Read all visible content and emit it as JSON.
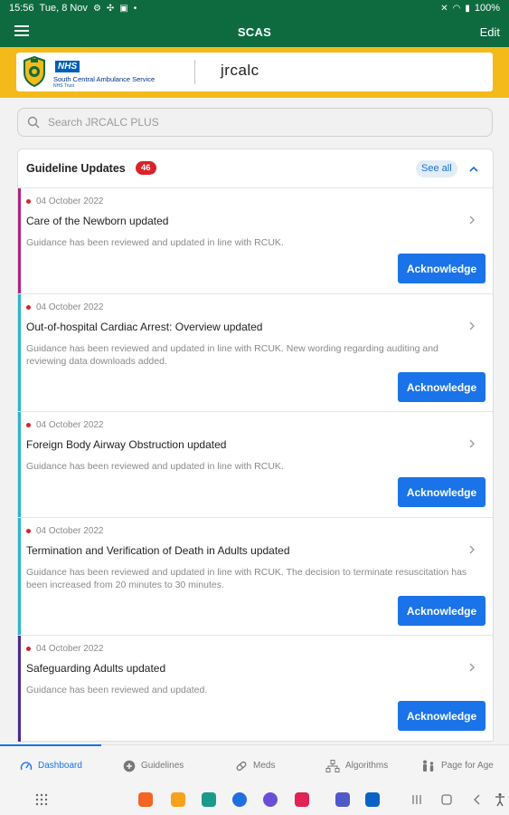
{
  "status_bar": {
    "time": "15:56",
    "date": "Tue, 8 Nov",
    "battery": "100%"
  },
  "app_bar": {
    "title": "SCAS",
    "edit_label": "Edit"
  },
  "brand": {
    "nhs_logo": "NHS",
    "org_name": "South Central Ambulance Service",
    "org_trust": "NHS Trust",
    "app_name": "jrcalc"
  },
  "search": {
    "placeholder": "Search JRCALC PLUS"
  },
  "updates": {
    "title": "Guideline Updates",
    "count": "46",
    "see_all_label": "See all",
    "ack_label": "Acknowledge",
    "items": [
      {
        "date": "04 October 2022",
        "title": "Care of the Newborn updated",
        "description": "Guidance has been reviewed and updated in line with RCUK.",
        "accent_color": "#b0227e"
      },
      {
        "date": "04 October 2022",
        "title": "Out-of-hospital Cardiac Arrest: Overview updated",
        "description": "Guidance has been reviewed and updated in line with RCUK. New wording regarding auditing and reviewing data downloads added.",
        "accent_color": "#2bb5c9"
      },
      {
        "date": "04 October 2022",
        "title": "Foreign Body Airway Obstruction updated",
        "description": "Guidance has been reviewed and updated in line with RCUK.",
        "accent_color": "#2bb5c9"
      },
      {
        "date": "04 October 2022",
        "title": "Termination and Verification of Death in Adults updated",
        "description": "Guidance has been reviewed and updated in line with RCUK. The decision to terminate resuscitation has been increased from 20 minutes to 30 minutes.",
        "accent_color": "#2bb5c9"
      },
      {
        "date": "04 October 2022",
        "title": "Safeguarding Adults updated",
        "description": "Guidance has been reviewed and updated.",
        "accent_color": "#4b2a8e"
      }
    ]
  },
  "tabs": [
    {
      "label": "Dashboard",
      "icon": "dashboard-icon",
      "active": true
    },
    {
      "label": "Guidelines",
      "icon": "plus-circle-icon",
      "active": false
    },
    {
      "label": "Meds",
      "icon": "pill-icon",
      "active": false
    },
    {
      "label": "Algorithms",
      "icon": "algorithm-icon",
      "active": false
    },
    {
      "label": "Page for Age",
      "icon": "people-icon",
      "active": false
    }
  ],
  "colors": {
    "app_bar": "#0d6b3f",
    "brand_band": "#f3ba19",
    "accent_blue": "#1a73e8",
    "badge_red": "#d8232a"
  }
}
